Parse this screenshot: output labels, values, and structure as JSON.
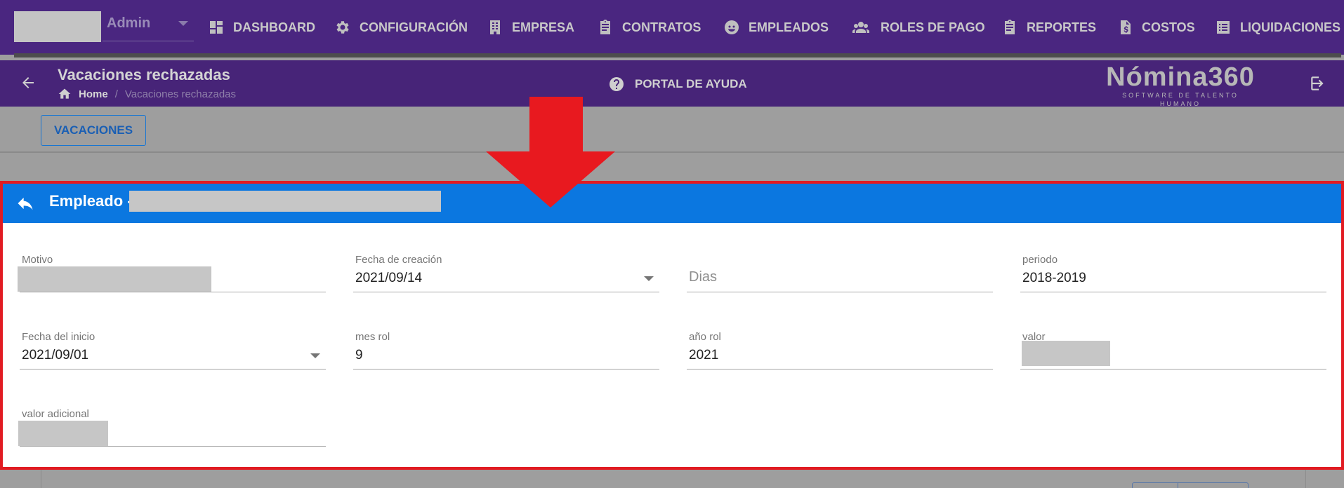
{
  "nav": {
    "user": {
      "name": "Admin"
    },
    "items": [
      {
        "label": "DASHBOARD",
        "icon": "dashboard-icon"
      },
      {
        "label": "CONFIGURACIÓN",
        "icon": "gear-icon"
      },
      {
        "label": "EMPRESA",
        "icon": "building-icon"
      },
      {
        "label": "CONTRATOS",
        "icon": "clipboard-icon"
      },
      {
        "label": "EMPLEADOS",
        "icon": "face-icon"
      },
      {
        "label": "ROLES DE PAGO",
        "icon": "people-icon"
      },
      {
        "label": "REPORTES",
        "icon": "clipboard-icon"
      },
      {
        "label": "COSTOS",
        "icon": "money-file-icon"
      },
      {
        "label": "LIQUIDACIONES",
        "icon": "list-icon"
      }
    ]
  },
  "header": {
    "title": "Vacaciones rechazadas",
    "breadcrumb": {
      "home": "Home",
      "separator": "/",
      "current": "Vacaciones rechazadas"
    },
    "help_label": "PORTAL DE AYUDA",
    "logo_main": "Nómina360",
    "logo_sub": "SOFTWARE DE TALENTO HUMANO"
  },
  "toolbar": {
    "vacaciones_label": "VACACIONES"
  },
  "dialog": {
    "title": "Empleado -",
    "fields": {
      "motivo": {
        "label": "Motivo",
        "value": ""
      },
      "fecha_creacion": {
        "label": "Fecha de creación",
        "value": "2021/09/14"
      },
      "dias": {
        "label": "",
        "placeholder": "Dias"
      },
      "periodo": {
        "label": "periodo",
        "value": "2018-2019"
      },
      "fecha_inicio": {
        "label": "Fecha del inicio",
        "value": "2021/09/01"
      },
      "mes_rol": {
        "label": "mes rol",
        "value": "9"
      },
      "anio_rol": {
        "label": "año rol",
        "value": "2021"
      },
      "valor": {
        "label": "valor",
        "value": ""
      },
      "valor_adicional": {
        "label": "valor adicional",
        "value": ""
      }
    }
  },
  "colors": {
    "nav_bg": "#4a2680",
    "dialog_header": "#0b77e0",
    "highlight_red": "#e11b22"
  }
}
